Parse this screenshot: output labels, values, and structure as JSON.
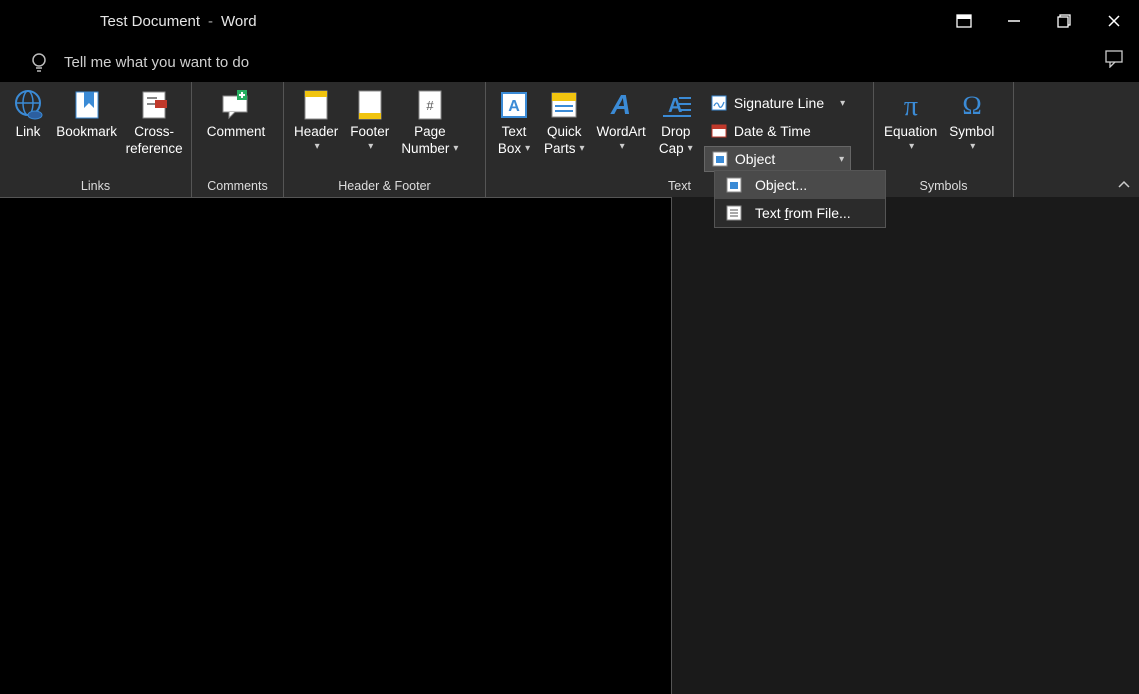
{
  "title": {
    "doc": "Test Document",
    "sep": "-",
    "app": "Word"
  },
  "tellme": "Tell me what you want to do",
  "groups": {
    "links": {
      "label": "Links",
      "link": "Link",
      "bookmark": "Bookmark",
      "cross1": "Cross-",
      "cross2": "reference"
    },
    "comments": {
      "label": "Comments",
      "comment": "Comment"
    },
    "headerfooter": {
      "label": "Header & Footer",
      "header": "Header",
      "footer": "Footer",
      "page1": "Page",
      "page2": "Number"
    },
    "text": {
      "label": "Text",
      "textbox1": "Text",
      "textbox2": "Box",
      "quick1": "Quick",
      "quick2": "Parts",
      "wordart": "WordArt",
      "drop1": "Drop",
      "drop2": "Cap",
      "sigline": "Signature Line",
      "datetime": "Date & Time",
      "object": "Object"
    },
    "symbols": {
      "label": "Symbols",
      "equation": "Equation",
      "symbol": "Symbol"
    }
  },
  "dropdown": {
    "object": "Object...",
    "textfromfile_pre": "Text ",
    "textfromfile_u": "f",
    "textfromfile_post": "rom File..."
  }
}
